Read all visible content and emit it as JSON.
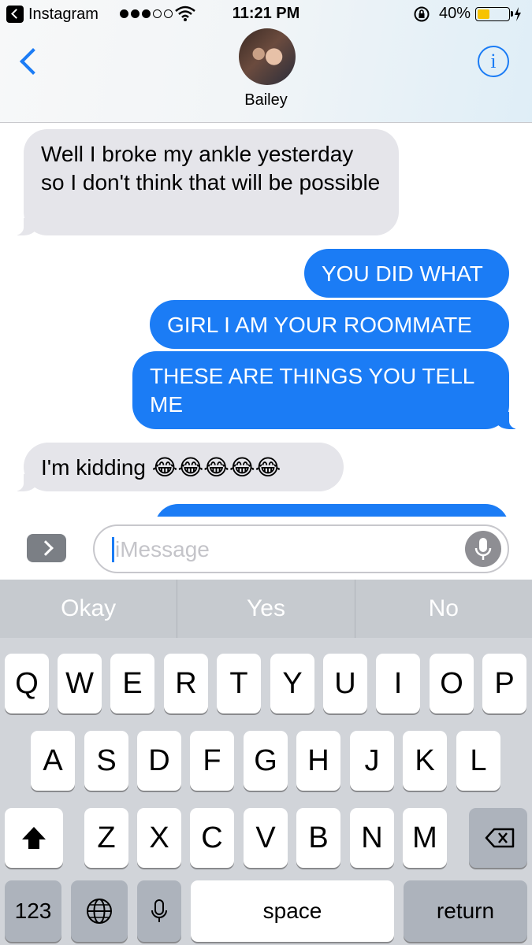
{
  "status_bar": {
    "back_app": "Instagram",
    "time": "11:21 PM",
    "battery": "40%",
    "battery_level": 0.4,
    "signal_bars_filled": 3,
    "signal_bars_total": 5
  },
  "nav": {
    "contact_name": "Bailey",
    "info_label": "i",
    "back_icon": "chevron-left-icon",
    "accent_color": "#1b7cf5"
  },
  "messages": [
    {
      "direction": "incoming",
      "text": "Well I broke my ankle yesterday so I don't think that will be possible"
    },
    {
      "direction": "outgoing",
      "text": "YOU DID WHAT"
    },
    {
      "direction": "outgoing",
      "text": "GIRL I AM YOUR ROOMMATE"
    },
    {
      "direction": "outgoing",
      "text": "THESE ARE THINGS YOU TELL ME"
    },
    {
      "direction": "incoming",
      "text": "I'm kidding 😂😂😂😂😂"
    },
    {
      "direction": "outgoing",
      "text": ""
    }
  ],
  "compose": {
    "placeholder": "iMessage"
  },
  "keyboard": {
    "predictions": [
      "Okay",
      "Yes",
      "No"
    ],
    "row1": [
      "Q",
      "W",
      "E",
      "R",
      "T",
      "Y",
      "U",
      "I",
      "O",
      "P"
    ],
    "row2": [
      "A",
      "S",
      "D",
      "F",
      "G",
      "H",
      "J",
      "K",
      "L"
    ],
    "row3": [
      "Z",
      "X",
      "C",
      "V",
      "B",
      "N",
      "M"
    ],
    "numbers_label": "123",
    "space_label": "space",
    "return_label": "return"
  }
}
